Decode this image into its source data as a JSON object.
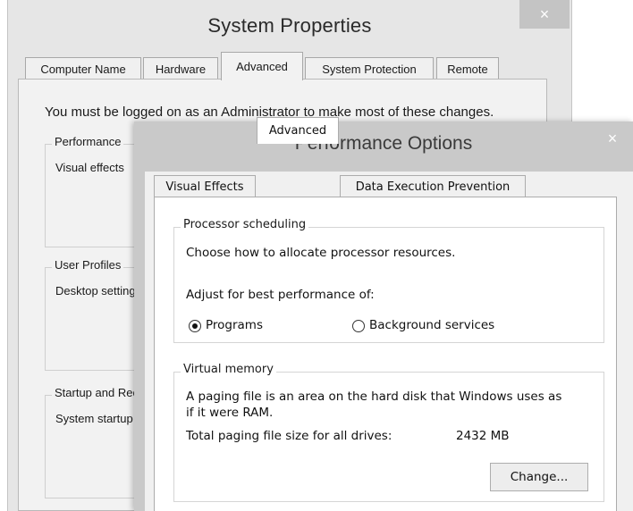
{
  "system_properties": {
    "title": "System Properties",
    "close_glyph": "×",
    "tabs": [
      {
        "label": "Computer Name"
      },
      {
        "label": "Hardware"
      },
      {
        "label": "Advanced"
      },
      {
        "label": "System Protection"
      },
      {
        "label": "Remote"
      }
    ],
    "active_tab": "Advanced",
    "admin_note": "You must be logged on as an Administrator to make most of these changes.",
    "groups": {
      "performance": {
        "label": "Performance",
        "text": "Visual effects"
      },
      "user_profiles": {
        "label": "User Profiles",
        "text": "Desktop settings"
      },
      "startup": {
        "label": "Startup and Recovery",
        "text": "System startup"
      }
    }
  },
  "performance_options": {
    "title": "Performance Options",
    "close_glyph": "×",
    "tabs": [
      {
        "label": "Visual Effects"
      },
      {
        "label": "Advanced"
      },
      {
        "label": "Data Execution Prevention"
      }
    ],
    "active_tab": "Advanced",
    "processor_scheduling": {
      "label": "Processor scheduling",
      "description": "Choose how to allocate processor resources.",
      "adjust_label": "Adjust for best performance of:",
      "options": [
        {
          "label": "Programs",
          "checked": true
        },
        {
          "label": "Background services",
          "checked": false
        }
      ]
    },
    "virtual_memory": {
      "label": "Virtual memory",
      "description_line1": "A paging file is an area on the hard disk that Windows uses as",
      "description_line2": "if it were RAM.",
      "total_label": "Total paging file size for all drives:",
      "total_value": "2432 MB",
      "change_button": "Change..."
    }
  },
  "colors": {
    "title_bar_back": "#e6e6e6",
    "title_bar_front": "#c9c9c9",
    "close_button_back": "#c4c4c4",
    "panel_white": "#ffffff"
  }
}
